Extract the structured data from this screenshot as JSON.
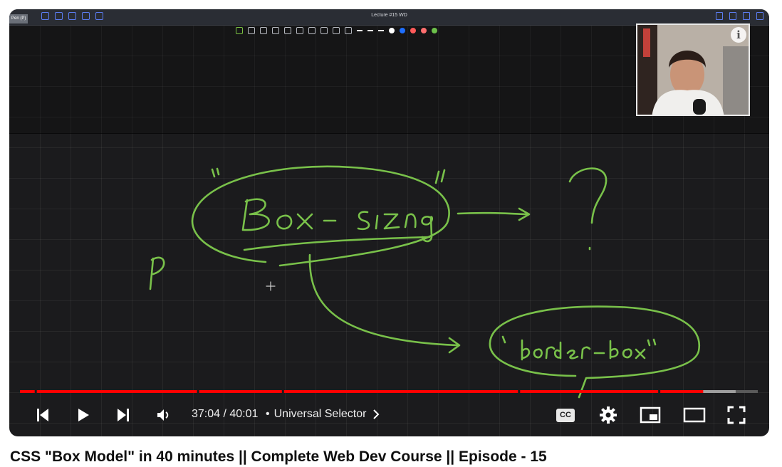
{
  "app": {
    "window_title": "Lecture #15 WD",
    "pen_label": "Pen (P)"
  },
  "player": {
    "current_time": "37:04",
    "duration": "40:01",
    "time_display": "37:04 / 40:01",
    "chapter_separator": "•",
    "chapter_title": "Universal Selector",
    "progress_fraction": 0.926,
    "buffer_fraction": 0.97,
    "cc_label": "CC",
    "info_label": "i"
  },
  "video": {
    "title": "CSS \"Box Model\" in 40 minutes || Complete Web Dev Course || Episode - 15"
  },
  "whiteboard": {
    "ink_color": "#79c14a",
    "colors": [
      "#ffffff",
      "#1e6fff",
      "#ff5a5a",
      "#ff6f6f",
      "#6cc04a"
    ]
  },
  "colors": {
    "progress_played": "#ff0000",
    "progress_buffered": "#9e9e9e",
    "progress_track": "#5a5a5a"
  },
  "icons": [
    "previous-icon",
    "play-icon",
    "next-icon",
    "volume-icon",
    "chevron-right-icon",
    "captions-icon",
    "settings-gear-icon",
    "miniplayer-icon",
    "theater-mode-icon",
    "fullscreen-icon"
  ]
}
